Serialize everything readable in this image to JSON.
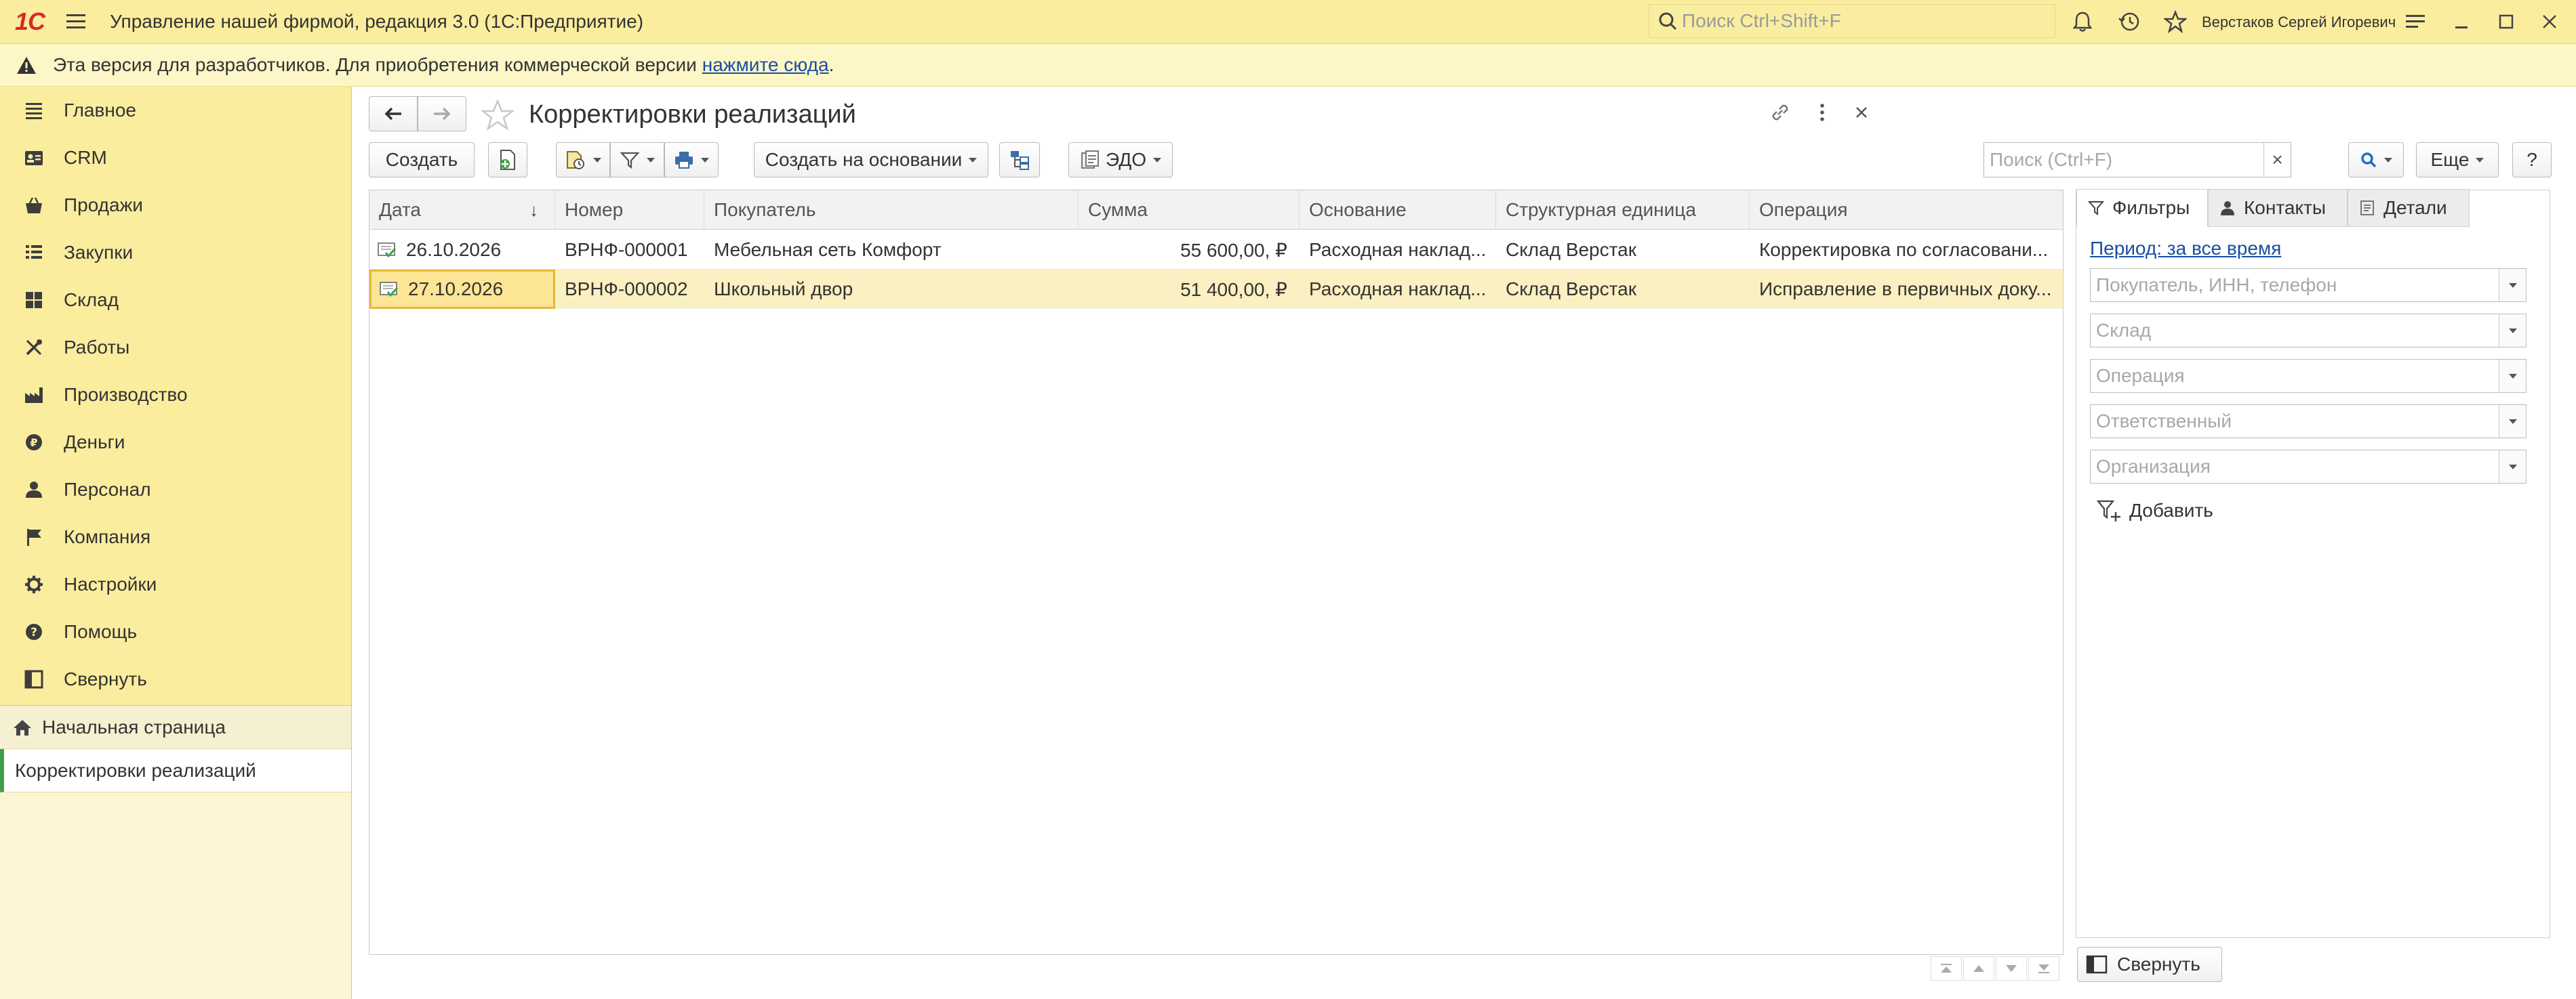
{
  "titlebar": {
    "logo": "1С",
    "app_title": "Управление нашей фирмой, редакция 3.0  (1С:Предприятие)",
    "search_placeholder": "Поиск Ctrl+Shift+F",
    "user": "Верстаков Сергей Игоревич"
  },
  "banner": {
    "text": "Эта версия для разработчиков. Для приобретения коммерческой версии",
    "link": "нажмите сюда",
    "period_char": "."
  },
  "sidebar": {
    "items": [
      {
        "label": "Главное",
        "icon": "list-icon"
      },
      {
        "label": "CRM",
        "icon": "contacts-card-icon"
      },
      {
        "label": "Продажи",
        "icon": "basket-icon"
      },
      {
        "label": "Закупки",
        "icon": "purchase-list-icon"
      },
      {
        "label": "Склад",
        "icon": "warehouse-grid-icon"
      },
      {
        "label": "Работы",
        "icon": "tools-icon"
      },
      {
        "label": "Производство",
        "icon": "factory-icon"
      },
      {
        "label": "Деньги",
        "icon": "ruble-coin-icon"
      },
      {
        "label": "Персонал",
        "icon": "person-icon"
      },
      {
        "label": "Компания",
        "icon": "flag-icon"
      },
      {
        "label": "Настройки",
        "icon": "gear-icon"
      },
      {
        "label": "Помощь",
        "icon": "help-icon"
      },
      {
        "label": "Свернуть",
        "icon": "collapse-panel-icon"
      }
    ],
    "open_windows": [
      {
        "label": "Начальная страница",
        "icon": "home-icon"
      },
      {
        "label": "Корректировки реализаций",
        "active": true
      }
    ]
  },
  "form": {
    "title": "Корректировки реализаций",
    "toolbar": {
      "create": "Создать",
      "create_based_on": "Создать на основании",
      "edo": "ЭДО",
      "search_placeholder": "Поиск (Ctrl+F)",
      "clear": "×",
      "more": "Еще",
      "help": "?"
    },
    "table": {
      "columns": [
        "Дата",
        "Номер",
        "Покупатель",
        "Сумма",
        "Основание",
        "Структурная единица",
        "Операция"
      ],
      "sort_indicator": "↓",
      "rows": [
        {
          "date": "26.10.2026",
          "number": "ВРНФ-000001",
          "buyer": "Мебельная сеть Комфорт",
          "amount": "55 600,00, ₽",
          "basis": "Расходная наклад...",
          "unit": "Склад Верстак",
          "operation": "Корректировка по согласовани...",
          "selected": false
        },
        {
          "date": "27.10.2026",
          "number": "ВРНФ-000002",
          "buyer": "Школьный двор",
          "amount": "51 400,00, ₽",
          "basis": "Расходная наклад...",
          "unit": "Склад Верстак",
          "operation": "Исправление в первичных доку...",
          "selected": true
        }
      ]
    },
    "right_panel": {
      "tabs": [
        "Фильтры",
        "Контакты",
        "Детали"
      ],
      "period_link": "Период: за все время",
      "filters": [
        "Покупатель, ИНН, телефон",
        "Склад",
        "Операция",
        "Ответственный",
        "Организация"
      ],
      "add_filter": "Добавить",
      "collapse": "Свернуть"
    }
  },
  "colors": {
    "titlebar_bg": "#fbed9e",
    "sidebar_bg": "#fbed9e",
    "selected_row": "#fbf0c1",
    "link": "#1a4ea3",
    "logo": "#d62a2a"
  }
}
